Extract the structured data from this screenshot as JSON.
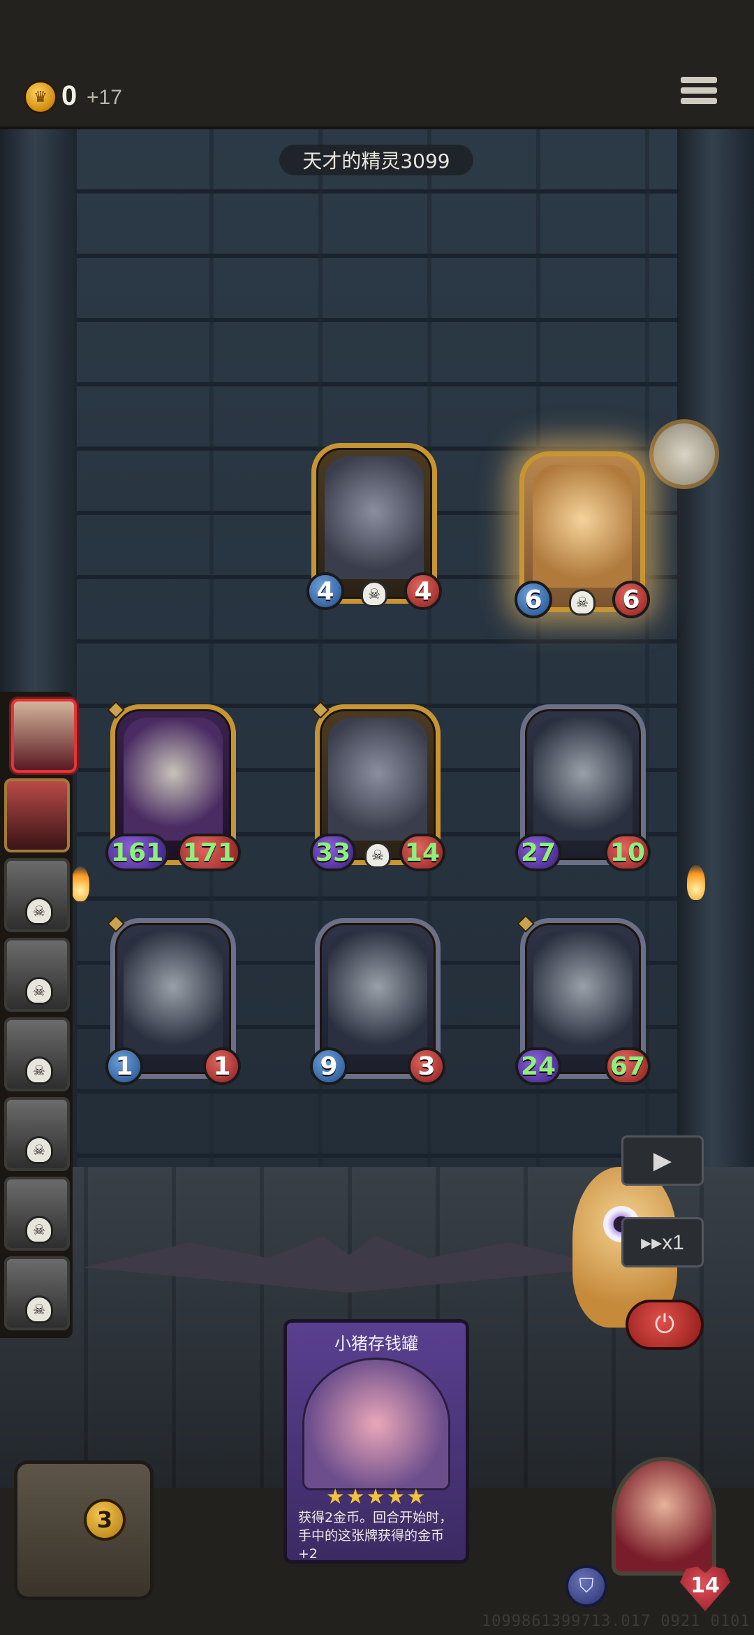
{
  "header": {
    "coin_icon_label": "♛",
    "coins": "0",
    "coin_income": "+17",
    "menu_icon": "hamburger-menu-icon"
  },
  "opponent": {
    "name": "天才的精灵3099"
  },
  "opponent_board": [
    {
      "atk": "4",
      "hp": "4"
    },
    {
      "atk": "6",
      "hp": "6"
    }
  ],
  "player_board_row1": [
    {
      "atk": "161",
      "hp": "171"
    },
    {
      "atk": "33",
      "hp": "14"
    },
    {
      "atk": "27",
      "hp": "10"
    }
  ],
  "player_board_row2": [
    {
      "atk": "1",
      "hp": "1"
    },
    {
      "atk": "9",
      "hp": "3"
    },
    {
      "atk": "24",
      "hp": "67"
    }
  ],
  "controls": {
    "play_label": "▶",
    "speed_label": "▸▸x1",
    "power_label": "⏻"
  },
  "hand_card": {
    "title": "小猪存钱罐",
    "stars": "★★★★★",
    "description": "获得2金币。回合开始时，手中的这张牌获得的金币+2"
  },
  "chest": {
    "count": "3"
  },
  "hero": {
    "health": "14",
    "armor_icon": "shield-icon"
  },
  "footer": {
    "build_id": "1099861399713.017 0921 0101"
  },
  "colors": {
    "gold_border": "#c79533",
    "silver_border": "#6b6f87",
    "attack_blue": "#1f4f8e",
    "health_red": "#8e1f1f",
    "buff_green": "#8df07a"
  }
}
